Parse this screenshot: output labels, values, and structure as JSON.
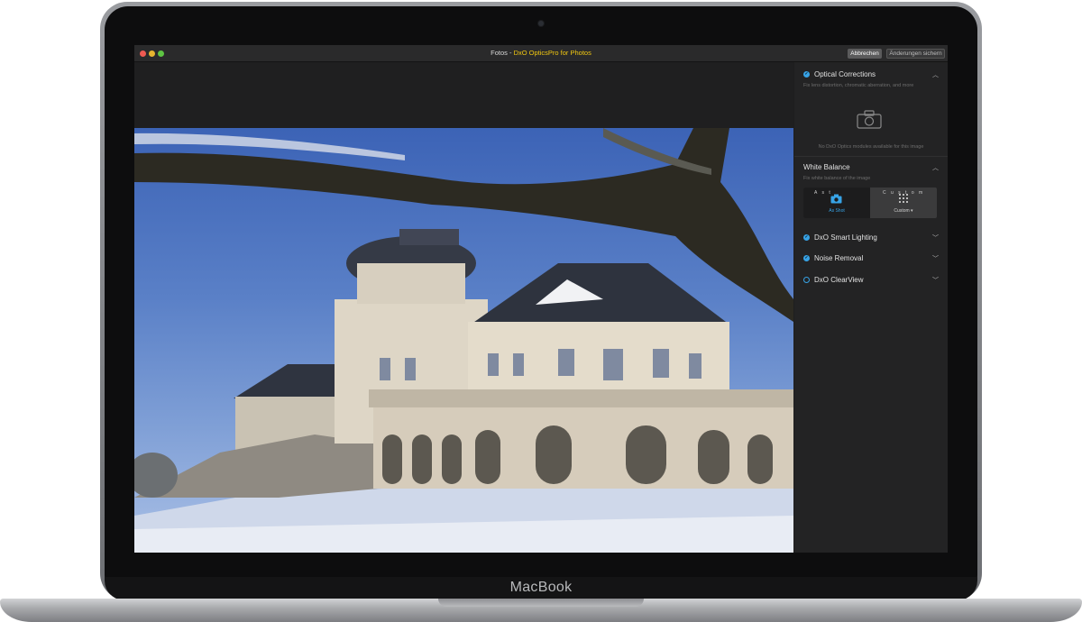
{
  "device": {
    "brand": "MacBook"
  },
  "window": {
    "title_app": "Fotos",
    "title_sep": " - ",
    "title_plugin": "DxO OpticsPro for Photos",
    "buttons": {
      "cancel": "Abbrechen",
      "save": "Änderungen sichern"
    }
  },
  "panel": {
    "optical": {
      "title": "Optical Corrections",
      "subtitle": "Fix lens distortion, chromatic aberration, and more",
      "empty_message": "No DxO Optics modules available for this image",
      "icon": "camera-icon"
    },
    "white_balance": {
      "title": "White Balance",
      "subtitle": "Fix white balance of the image",
      "left_letters": "A  s     t",
      "left_label": "As Shot",
      "right_letters": "C  u  s  t  o  m",
      "right_label": "Custom ▾"
    },
    "smart_lighting": {
      "title": "DxO Smart Lighting"
    },
    "noise_removal": {
      "title": "Noise Removal"
    },
    "clearview": {
      "title": "DxO ClearView"
    }
  },
  "colors": {
    "accent": "#37a3e6",
    "plugin_title": "#f2c811",
    "panel_bg": "#232324"
  }
}
